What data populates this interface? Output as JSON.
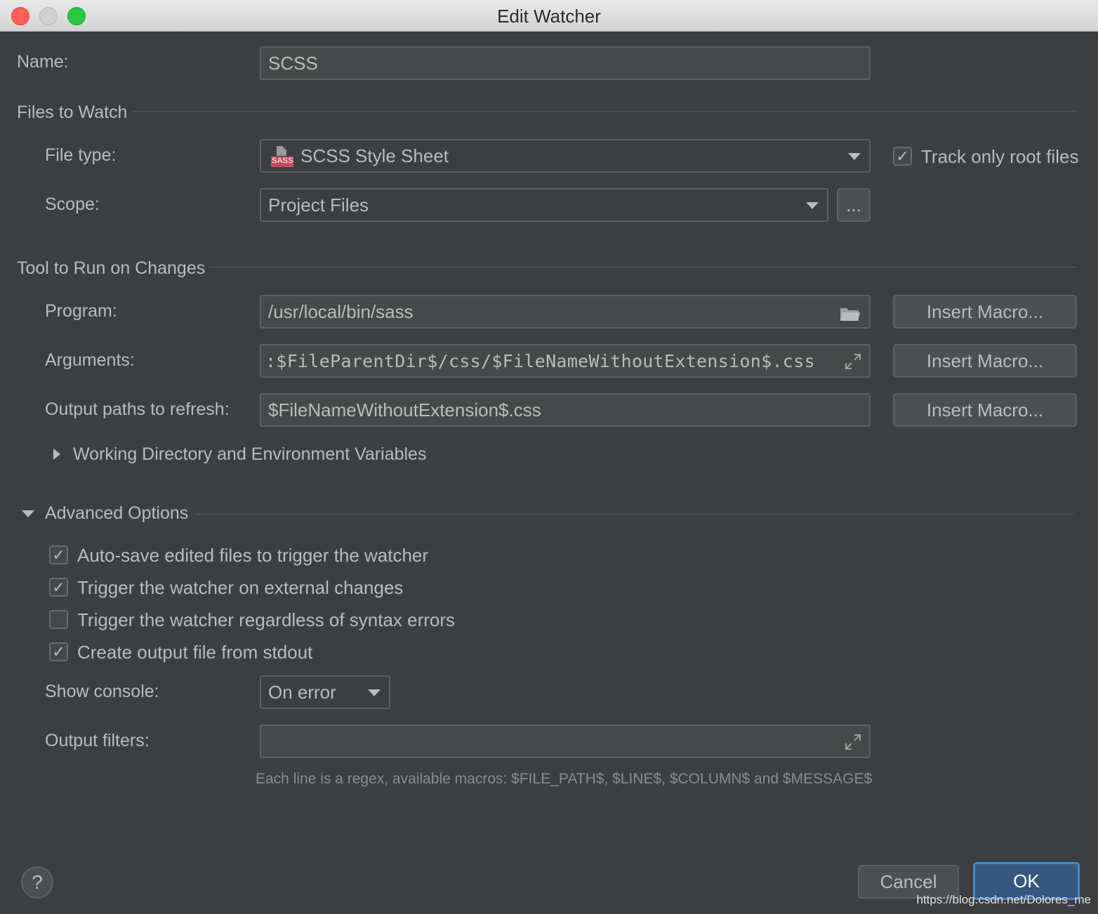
{
  "window": {
    "title": "Edit Watcher"
  },
  "name": {
    "label": "Name:",
    "value": "SCSS"
  },
  "files_section": {
    "title": "Files to Watch",
    "file_type_label": "File type:",
    "file_type_value": "SCSS Style Sheet",
    "file_type_icon_text": "SASS",
    "track_root_label": "Track only root files",
    "track_root_checked": true,
    "scope_label": "Scope:",
    "scope_value": "Project Files",
    "scope_more": "..."
  },
  "tool_section": {
    "title": "Tool to Run on Changes",
    "program_label": "Program:",
    "program_value": "/usr/local/bin/sass",
    "arguments_label": "Arguments:",
    "arguments_value": ":$FileParentDir$/css/$FileNameWithoutExtension$.css",
    "output_paths_label": "Output paths to refresh:",
    "output_paths_value": "$FileNameWithoutExtension$.css",
    "insert_macro": "Insert Macro...",
    "working_dir_label": "Working Directory and Environment Variables"
  },
  "advanced_section": {
    "title": "Advanced Options",
    "options": [
      {
        "label": "Auto-save edited files to trigger the watcher",
        "checked": true
      },
      {
        "label": "Trigger the watcher on external changes",
        "checked": true
      },
      {
        "label": "Trigger the watcher regardless of syntax errors",
        "checked": false
      },
      {
        "label": "Create output file from stdout",
        "checked": true
      }
    ],
    "show_console_label": "Show console:",
    "show_console_value": "On error",
    "output_filters_label": "Output filters:",
    "output_filters_value": "",
    "hint": "Each line is a regex, available macros: $FILE_PATH$, $LINE$, $COLUMN$ and $MESSAGE$"
  },
  "footer": {
    "help": "?",
    "cancel": "Cancel",
    "ok": "OK",
    "watermark": "https://blog.csdn.net/Dolores_me"
  },
  "check_glyph": "✓",
  "colors": {
    "background": "#3c3f41",
    "field": "#45494a",
    "accent": "#365880"
  }
}
